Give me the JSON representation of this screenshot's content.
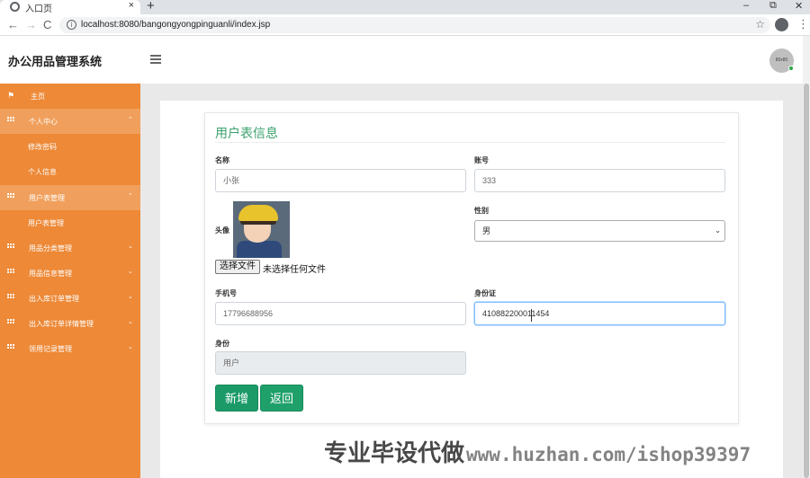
{
  "browser": {
    "tab_title": "入口页",
    "tab_close": "×",
    "new_tab": "+",
    "minimize": "–",
    "restore": "⧉",
    "close": "✕",
    "back": "←",
    "forward": "→",
    "reload": "C",
    "info": "i",
    "url": "localhost:8080/bangongyongpinguanli/index.jsp",
    "star": "☆",
    "menu": "⋮"
  },
  "header": {
    "brand": "办公用品管理系统",
    "avatar_text": "80x80"
  },
  "sidebar": {
    "items": [
      {
        "label": "主页",
        "icon": "flag-icon"
      },
      {
        "label": "个人中心",
        "icon": "grid-icon",
        "arrow": "⌃"
      },
      {
        "label": "修改密码"
      },
      {
        "label": "个人信息"
      },
      {
        "label": "用户表管理",
        "icon": "grid-icon",
        "arrow": "⌃"
      },
      {
        "label": "用户表管理"
      },
      {
        "label": "用品分类管理",
        "icon": "grid-icon",
        "arrow": "⌄"
      },
      {
        "label": "用品信息管理",
        "icon": "grid-icon",
        "arrow": "⌄"
      },
      {
        "label": "出入库订单管理",
        "icon": "grid-icon",
        "arrow": "⌄"
      },
      {
        "label": "出入库订单详情管理",
        "icon": "grid-icon",
        "arrow": "⌄"
      },
      {
        "label": "领用记录管理",
        "icon": "grid-icon",
        "arrow": "⌄"
      }
    ]
  },
  "form": {
    "title": "用户表信息",
    "name_label": "名称",
    "name_value": "小张",
    "account_label": "账号",
    "account_value": "333",
    "avatar_label": "头像",
    "gender_label": "性别",
    "gender_value": "男",
    "file_button": "选择文件",
    "file_text": "未选择任何文件",
    "phone_label": "手机号",
    "phone_value": "17796688956",
    "idcard_label": "身份证",
    "idcard_value": "410882200011454",
    "role_label": "身份",
    "role_value": "用户",
    "submit_label": "新增",
    "back_label": "返回"
  },
  "watermark": {
    "text_cn": "专业毕设代做",
    "text_url": "www.huzhan.com/ishop39397"
  }
}
